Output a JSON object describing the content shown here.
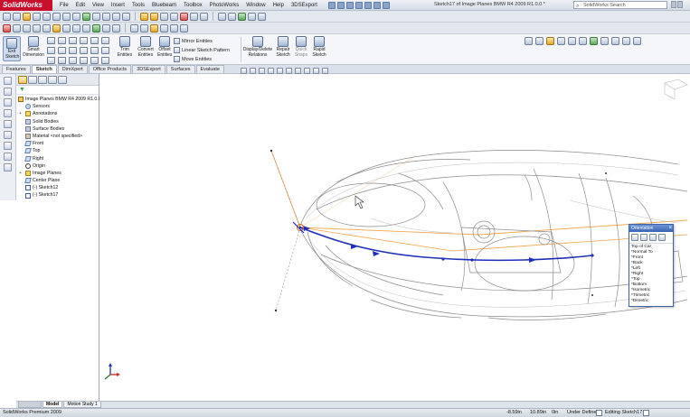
{
  "app": {
    "logo_text": "SolidWorks",
    "menu": [
      "File",
      "Edit",
      "View",
      "Insert",
      "Tools",
      "Bluebeam",
      "Toolbox",
      "PhotoWorks",
      "Window",
      "Help",
      "3DSExport"
    ],
    "document_title": "Sketch17 of Image Planes BMW R4 2009 R1.0.0 *",
    "search_placeholder": "SolidWorks Search"
  },
  "command_manager": {
    "exit_sketch": "Exit Sketch",
    "smart_dimension": "Smart Dimension",
    "trim_entities": "Trim Entities",
    "convert_entities": "Convert Entities",
    "offset_entities": "Offset Entities",
    "mirror_entities": "Mirror Entities",
    "linear_sketch_pattern": "Linear Sketch Pattern",
    "move_entities": "Move Entities",
    "display_delete_relations": "Display/Delete Relations",
    "repair_sketch": "Repair Sketch",
    "quick_snaps": "Quick Snaps",
    "rapid_sketch": "Rapid Sketch"
  },
  "tabs": [
    "Features",
    "Sketch",
    "DimXpert",
    "Office Products",
    "3DSExport",
    "Surfaces",
    "Evaluate"
  ],
  "active_tab": "Sketch",
  "feature_tree": {
    "root": "Image Planes BMW R4 2009 R1.0.0",
    "items": [
      {
        "label": "Sensors",
        "icon": "sensor-icon",
        "expandable": false
      },
      {
        "label": "Annotations",
        "icon": "annotations-icon",
        "expandable": true
      },
      {
        "label": "Solid Bodies",
        "icon": "solid-bodies-icon",
        "expandable": false
      },
      {
        "label": "Surface Bodies",
        "icon": "surface-bodies-icon",
        "expandable": false
      },
      {
        "label": "Material <not specified>",
        "icon": "material-icon",
        "expandable": false
      },
      {
        "label": "Front",
        "icon": "plane-icon",
        "expandable": false
      },
      {
        "label": "Top",
        "icon": "plane-icon",
        "expandable": false
      },
      {
        "label": "Right",
        "icon": "plane-icon",
        "expandable": false
      },
      {
        "label": "Origin",
        "icon": "origin-icon",
        "expandable": false
      },
      {
        "label": "Image Planes",
        "icon": "folder-icon",
        "expandable": true
      },
      {
        "label": "Center Plane",
        "icon": "plane-icon",
        "expandable": false
      },
      {
        "label": "(-) Sketch12",
        "icon": "sketch-icon",
        "expandable": false
      },
      {
        "label": "(-) Sketch17",
        "icon": "sketch-icon",
        "expandable": false
      }
    ]
  },
  "orientation": {
    "title": "Orientation",
    "views": [
      "Top of Car",
      "*Normal To",
      "*Front",
      "*Back",
      "*Left",
      "*Right",
      "*Top",
      "*Bottom",
      "*Isometric",
      "*Trimetric",
      "*Dimetric"
    ]
  },
  "model_tabs": [
    "Model",
    "Motion Study 1"
  ],
  "status": {
    "left": "SolidWorks Premium 2009",
    "x": "-8.59in",
    "y": "10.89in",
    "z": "0in",
    "state": "Under Defined",
    "editing": "Editing Sketch17"
  },
  "colors": {
    "sketch_curve": "#1f2fb8",
    "plane_outline": "#f2a44a",
    "car_lines": "#8c8c8c",
    "accent": "#c8102e"
  }
}
